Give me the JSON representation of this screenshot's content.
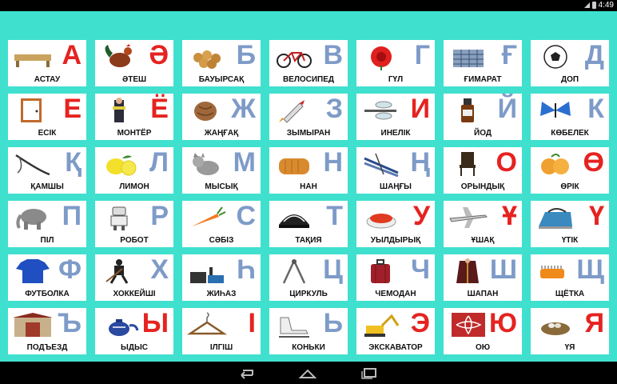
{
  "status": {
    "time": "4:49"
  },
  "palette": {
    "background": "#40E0CF",
    "letter_red": "#E52320",
    "letter_blue": "#7E9BC8"
  },
  "cards": [
    {
      "letter": "А",
      "word": "АСТАУ",
      "color": "red",
      "icon": "trough"
    },
    {
      "letter": "Ә",
      "word": "ӘТЕШ",
      "color": "red",
      "icon": "rooster"
    },
    {
      "letter": "Б",
      "word": "БАУЫРСАҚ",
      "color": "blue",
      "icon": "baursak"
    },
    {
      "letter": "В",
      "word": "ВЕЛОСИПЕД",
      "color": "blue",
      "icon": "bicycle"
    },
    {
      "letter": "Г",
      "word": "ГҮЛ",
      "color": "blue",
      "icon": "flower"
    },
    {
      "letter": "Ғ",
      "word": "ҒИМАРАТ",
      "color": "blue",
      "icon": "building"
    },
    {
      "letter": "Д",
      "word": "ДОП",
      "color": "blue",
      "icon": "ball"
    },
    {
      "letter": "Е",
      "word": "ЕСІК",
      "color": "red",
      "icon": "door"
    },
    {
      "letter": "Ё",
      "word": "МОНТЁР",
      "color": "red",
      "icon": "electrician"
    },
    {
      "letter": "Ж",
      "word": "ЖАҢҒАҚ",
      "color": "blue",
      "icon": "walnut"
    },
    {
      "letter": "З",
      "word": "ЗЫМЫРАН",
      "color": "blue",
      "icon": "rocket"
    },
    {
      "letter": "И",
      "word": "ИНЕЛІК",
      "color": "red",
      "icon": "dragonfly"
    },
    {
      "letter": "Й",
      "word": "ЙОД",
      "color": "blue",
      "icon": "iodine"
    },
    {
      "letter": "К",
      "word": "КӨБЕЛЕК",
      "color": "blue",
      "icon": "butterfly"
    },
    {
      "letter": "Қ",
      "word": "ҚАМШЫ",
      "color": "blue",
      "icon": "whip"
    },
    {
      "letter": "Л",
      "word": "ЛИМОН",
      "color": "blue",
      "icon": "lemon"
    },
    {
      "letter": "М",
      "word": "МЫСЫҚ",
      "color": "blue",
      "icon": "cat"
    },
    {
      "letter": "Н",
      "word": "НАН",
      "color": "blue",
      "icon": "bread"
    },
    {
      "letter": "Ң",
      "word": "ШАҢҒЫ",
      "color": "blue",
      "icon": "skis"
    },
    {
      "letter": "О",
      "word": "ОРЫНДЫҚ",
      "color": "red",
      "icon": "chair"
    },
    {
      "letter": "Ө",
      "word": "ӨРІК",
      "color": "red",
      "icon": "apricot"
    },
    {
      "letter": "П",
      "word": "ПІЛ",
      "color": "blue",
      "icon": "elephant"
    },
    {
      "letter": "Р",
      "word": "РОБОТ",
      "color": "blue",
      "icon": "robot"
    },
    {
      "letter": "С",
      "word": "СӘБІЗ",
      "color": "blue",
      "icon": "carrot"
    },
    {
      "letter": "Т",
      "word": "ТАҚИЯ",
      "color": "blue",
      "icon": "skullcap"
    },
    {
      "letter": "У",
      "word": "УЫЛДЫРЫҚ",
      "color": "red",
      "icon": "caviar"
    },
    {
      "letter": "Ұ",
      "word": "ҰШАҚ",
      "color": "red",
      "icon": "airplane"
    },
    {
      "letter": "Ү",
      "word": "ҮТІК",
      "color": "red",
      "icon": "iron"
    },
    {
      "letter": "Ф",
      "word": "ФУТБОЛКА",
      "color": "blue",
      "icon": "tshirt"
    },
    {
      "letter": "Х",
      "word": "ХОККЕЙШІ",
      "color": "blue",
      "icon": "hockey-player"
    },
    {
      "letter": "Һ",
      "word": "ЖИҺАЗ",
      "color": "blue",
      "icon": "furniture"
    },
    {
      "letter": "Ц",
      "word": "ЦИРКУЛЬ",
      "color": "blue",
      "icon": "compass"
    },
    {
      "letter": "Ч",
      "word": "ЧЕМОДАН",
      "color": "blue",
      "icon": "suitcase"
    },
    {
      "letter": "Ш",
      "word": "ШАПАН",
      "color": "blue",
      "icon": "robe"
    },
    {
      "letter": "Щ",
      "word": "ЩЁТКА",
      "color": "blue",
      "icon": "brush"
    },
    {
      "letter": "Ъ",
      "word": "ПОДЪЕЗД",
      "color": "blue",
      "icon": "entrance"
    },
    {
      "letter": "Ы",
      "word": "ЫДЫС",
      "color": "red",
      "icon": "teapot"
    },
    {
      "letter": "І",
      "word": "ІЛГІШ",
      "color": "red",
      "icon": "hanger"
    },
    {
      "letter": "Ь",
      "word": "КОНЬКИ",
      "color": "blue",
      "icon": "skates"
    },
    {
      "letter": "Э",
      "word": "ЭКСКАВАТОР",
      "color": "red",
      "icon": "excavator"
    },
    {
      "letter": "Ю",
      "word": "ОЮ",
      "color": "red",
      "icon": "ornament"
    },
    {
      "letter": "Я",
      "word": "ҮЯ",
      "color": "red",
      "icon": "nest"
    }
  ]
}
